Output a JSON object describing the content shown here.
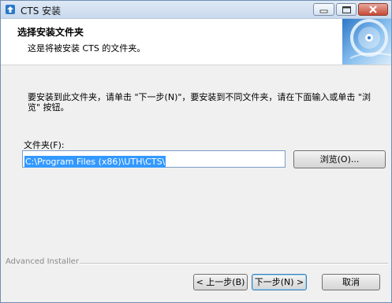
{
  "window": {
    "title": "CTS 安装",
    "controls": {
      "minimize": "minimize-icon",
      "maximize": "maximize-icon",
      "close": "close-icon"
    }
  },
  "header": {
    "title": "选择安装文件夹",
    "subtitle": "这是将被安装 CTS 的文件夹。"
  },
  "body": {
    "instruction": "要安装到此文件夹，请单击 \"下一步(N)\"，要安装到不同文件夹，请在下面输入或单击 \"浏览\" 按钮。",
    "folder_label": "文件夹(F):",
    "folder_path": "C:\\Program Files (x86)\\UTH\\CTS\\",
    "browse_label": "浏览(O)..."
  },
  "footer": {
    "brand": "Advanced Installer",
    "back_label": "< 上一步(B)",
    "next_label": "下一步(N) >",
    "cancel_label": "取消"
  },
  "colors": {
    "selection": "#3399ff",
    "titlebar": "#c9d9ed",
    "close_button": "#c84a35"
  }
}
